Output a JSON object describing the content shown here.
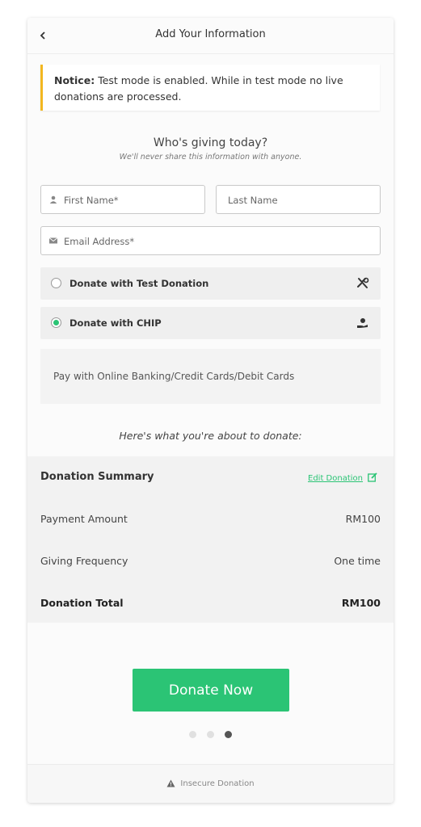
{
  "header": {
    "title": "Add Your Information",
    "back_icon": "chevron-left-icon"
  },
  "notice": {
    "label": "Notice:",
    "text": "Test mode is enabled. While in test mode no live donations are processed.",
    "accent": "#f2b720"
  },
  "giver": {
    "title": "Who's giving today?",
    "subtitle": "We'll never share this information with anyone."
  },
  "form": {
    "first_name_placeholder": "First Name*",
    "last_name_placeholder": "Last Name",
    "email_placeholder": "Email Address*"
  },
  "payment_options": [
    {
      "label": "Donate with Test Donation",
      "selected": false,
      "icon": "tools-icon"
    },
    {
      "label": "Donate with CHIP",
      "selected": true,
      "icon": "hand-donate-icon"
    }
  ],
  "payment_description": "Pay with Online Banking/Credit Cards/Debit Cards",
  "about_to_donate": "Here's what you're about to donate:",
  "summary": {
    "title": "Donation Summary",
    "edit_label": "Edit Donation",
    "payment_amount_label": "Payment Amount",
    "payment_amount_value": "RM100",
    "frequency_label": "Giving Frequency",
    "frequency_value": "One time",
    "total_label": "Donation Total",
    "total_value": "RM100"
  },
  "donate_button": "Donate Now",
  "steps": {
    "count": 3,
    "active": 3
  },
  "footer": {
    "text": "Insecure Donation"
  },
  "colors": {
    "accent_green": "#2bc475",
    "notice_yellow": "#f2b720"
  }
}
